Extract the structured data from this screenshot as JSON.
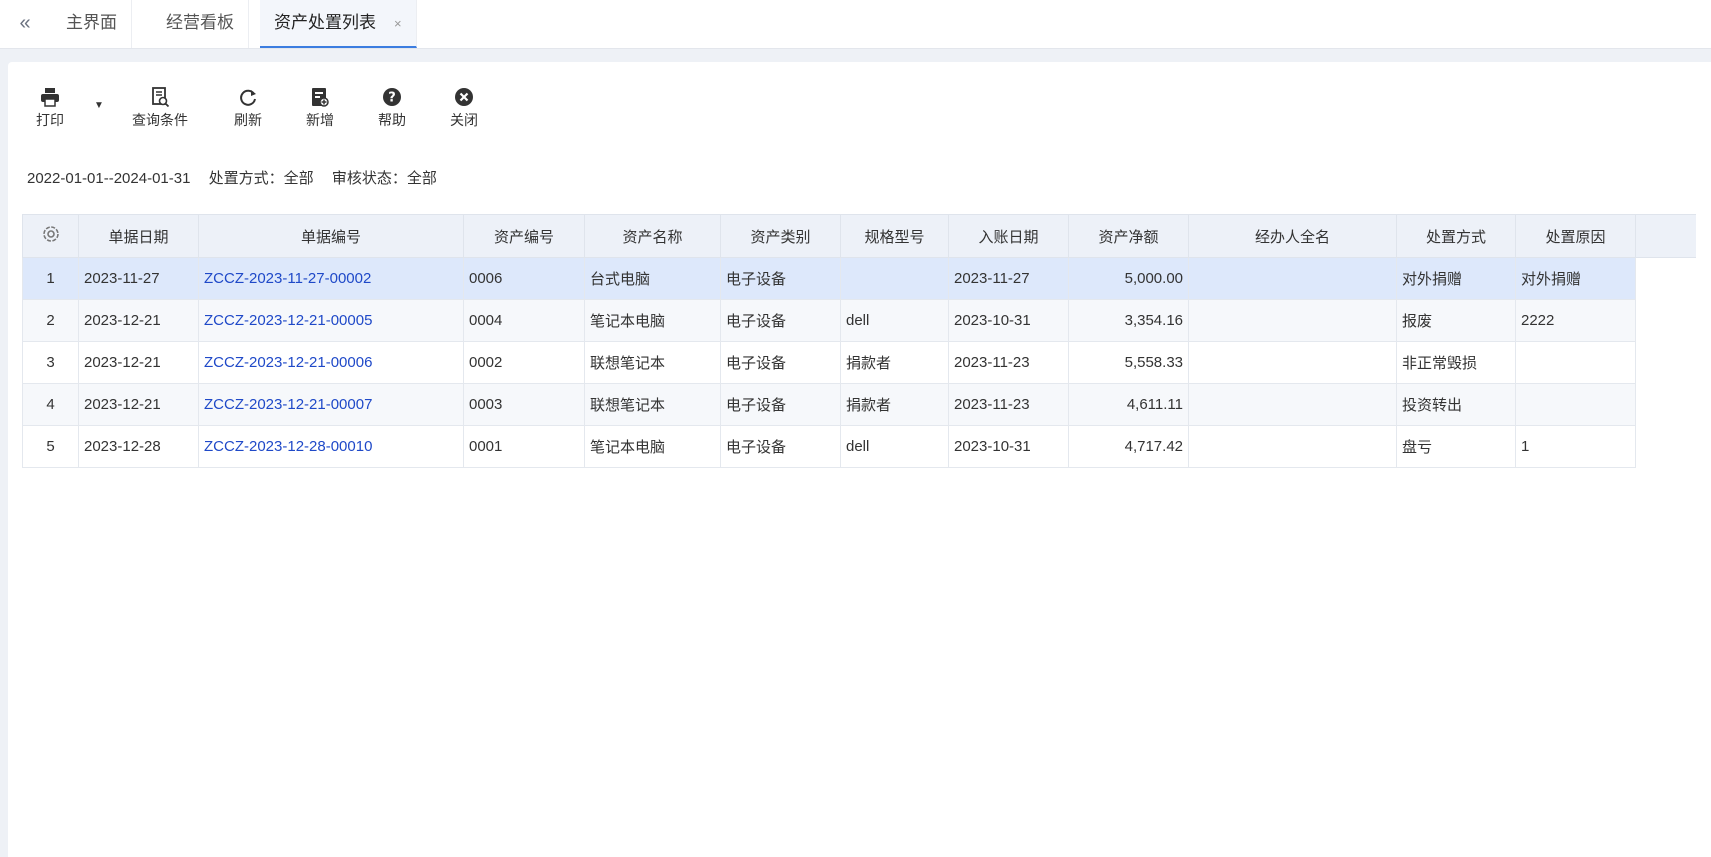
{
  "tabs": {
    "collapse_glyph": "«",
    "items": [
      {
        "label": "主界面"
      },
      {
        "label": "经营看板"
      },
      {
        "label": "资产处置列表",
        "close": "×"
      }
    ]
  },
  "toolbar": {
    "print": "打印",
    "query": "查询条件",
    "refresh": "刷新",
    "add": "新增",
    "help": "帮助",
    "close": "关闭"
  },
  "filter": {
    "date_range": "2022-01-01--2024-01-31",
    "method": "处置方式：全部",
    "status": "审核状态：全部"
  },
  "table": {
    "headers": [
      "单据日期",
      "单据编号",
      "资产编号",
      "资产名称",
      "资产类别",
      "规格型号",
      "入账日期",
      "资产净额",
      "经办人全名",
      "处置方式",
      "处置原因"
    ],
    "rows": [
      [
        "1",
        "2023-11-27",
        "ZCCZ-2023-11-27-00002",
        "0006",
        "台式电脑",
        "电子设备",
        "",
        "2023-11-27",
        "5,000.00",
        "",
        "对外捐赠",
        "对外捐赠"
      ],
      [
        "2",
        "2023-12-21",
        "ZCCZ-2023-12-21-00005",
        "0004",
        "笔记本电脑",
        "电子设备",
        "dell",
        "2023-10-31",
        "3,354.16",
        "",
        "报废",
        "2222"
      ],
      [
        "3",
        "2023-12-21",
        "ZCCZ-2023-12-21-00006",
        "0002",
        "联想笔记本",
        "电子设备",
        "捐款者",
        "2023-11-23",
        "5,558.33",
        "",
        "非正常毁损",
        ""
      ],
      [
        "4",
        "2023-12-21",
        "ZCCZ-2023-12-21-00007",
        "0003",
        "联想笔记本",
        "电子设备",
        "捐款者",
        "2023-11-23",
        "4,611.11",
        "",
        "投资转出",
        ""
      ],
      [
        "5",
        "2023-12-28",
        "ZCCZ-2023-12-28-00010",
        "0001",
        "笔记本电脑",
        "电子设备",
        "dell",
        "2023-10-31",
        "4,717.42",
        "",
        "盘亏",
        "1"
      ]
    ]
  },
  "colors": {
    "link": "#1f49c8",
    "selected_row": "#dde8fb",
    "header_bg": "#edf1f8",
    "active_tab_underline": "#3b7de0"
  }
}
